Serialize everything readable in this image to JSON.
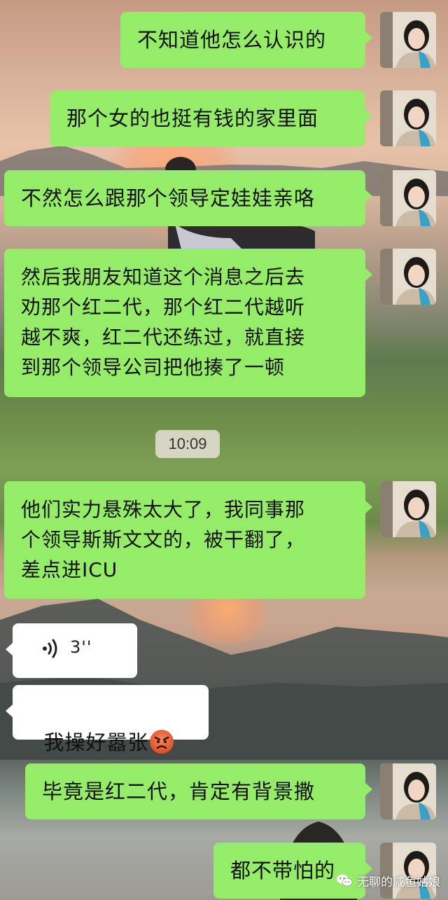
{
  "chat": {
    "messages": [
      {
        "side": "mine",
        "text": "不知道他怎么认识的"
      },
      {
        "side": "mine",
        "text": "那个女的也挺有钱的家里面"
      },
      {
        "side": "mine",
        "text": "不然怎么跟那个领导定娃娃亲咯"
      },
      {
        "side": "mine",
        "text": "然后我朋友知道这个消息之后去\n劝那个红二代，那个红二代越听\n越不爽，红二代还练过，就直接\n到那个领导公司把他揍了一顿"
      },
      {
        "side": "mine",
        "text": "他们实力悬殊太大了，我同事那\n个领导斯斯文文的，被干翻了，\n差点进ICU"
      },
      {
        "side": "mine",
        "text": "毕竟是红二代，肯定有背景撒"
      },
      {
        "side": "mine",
        "text": "都不带怕的"
      }
    ],
    "timestamp": "10:09",
    "voice_message": {
      "duration": "3''",
      "icon": "voice-wave-icon"
    },
    "reply": {
      "text_before_emoji": "我操好嚣张",
      "emoji": "angry-face-emoji",
      "text_after_emoji": "。"
    }
  },
  "watermark": {
    "icon": "wechat-icon",
    "text": "无聊的咸鱼姑娘"
  },
  "colors": {
    "my_bubble": "#95ec69",
    "their_bubble": "#ffffff",
    "timestamp_bg": "#e6e1d7"
  }
}
